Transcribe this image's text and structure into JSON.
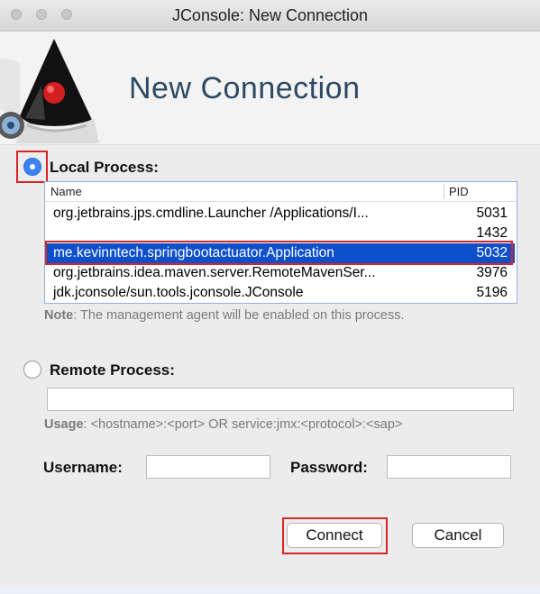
{
  "window": {
    "title": "JConsole: New Connection"
  },
  "banner": {
    "title": "New Connection"
  },
  "local": {
    "label": "Local Process:",
    "selected": true,
    "columns": {
      "name": "Name",
      "pid": "PID"
    },
    "rows": [
      {
        "name": "org.jetbrains.jps.cmdline.Launcher /Applications/I...",
        "pid": "5031"
      },
      {
        "name": "",
        "pid": "1432"
      },
      {
        "name": "me.kevinntech.springbootactuator.Application",
        "pid": "5032"
      },
      {
        "name": "org.jetbrains.idea.maven.server.RemoteMavenSer...",
        "pid": "3976"
      },
      {
        "name": "jdk.jconsole/sun.tools.jconsole.JConsole",
        "pid": "5196"
      }
    ],
    "selected_row_index": 2,
    "note_strong": "Note",
    "note_rest": ": The management agent will be enabled on this process."
  },
  "remote": {
    "label": "Remote Process:",
    "selected": false,
    "value": "",
    "usage_strong": "Usage",
    "usage_rest": ": <hostname>:<port> OR service:jmx:<protocol>:<sap>"
  },
  "credentials": {
    "username_label": "Username:",
    "username_value": "",
    "password_label": "Password:",
    "password_value": ""
  },
  "buttons": {
    "connect": "Connect",
    "cancel": "Cancel"
  },
  "colors": {
    "selection": "#0e4fcb",
    "highlight": "#d62626",
    "radio_on": "#3b82f6",
    "banner_text": "#2c4a63"
  }
}
